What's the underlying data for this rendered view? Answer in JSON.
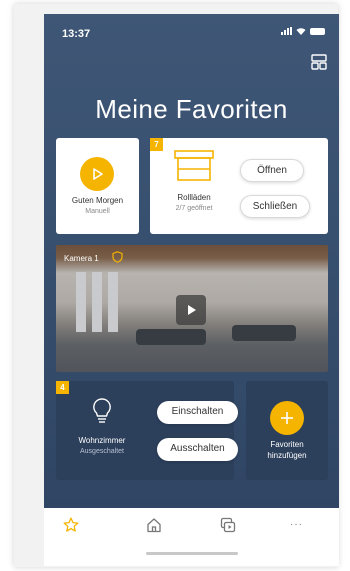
{
  "status": {
    "time": "13:37"
  },
  "header": {
    "title": "Meine Favoriten",
    "layout_icon": "grid-layout-icon"
  },
  "favorites": {
    "scene": {
      "name": "Guten Morgen",
      "mode": "Manuell",
      "icon": "play-icon",
      "accent": "#f5b400"
    },
    "shutters": {
      "badge": "7",
      "name": "Rollläden",
      "status": "2/7 geöffnet",
      "icon": "shutter-icon",
      "open_label": "Öffnen",
      "close_label": "Schließen"
    },
    "camera": {
      "name": "Kamera 1",
      "shield_icon": "shield-icon",
      "play_icon": "play-icon"
    },
    "light": {
      "badge": "4",
      "name": "Wohnzimmer",
      "status": "Ausgeschaltet",
      "icon": "bulb-icon",
      "on_label": "Einschalten",
      "off_label": "Ausschalten"
    },
    "add": {
      "label_line1": "Favoriten",
      "label_line2": "hinzufügen",
      "icon": "plus-icon"
    }
  },
  "nav": {
    "items": [
      {
        "icon": "star-icon",
        "active": true
      },
      {
        "icon": "home-icon",
        "active": false
      },
      {
        "icon": "scenes-icon",
        "active": false
      },
      {
        "icon": "more-icon",
        "active": false
      }
    ],
    "more_glyph": "···",
    "active_color": "#f5b400"
  }
}
